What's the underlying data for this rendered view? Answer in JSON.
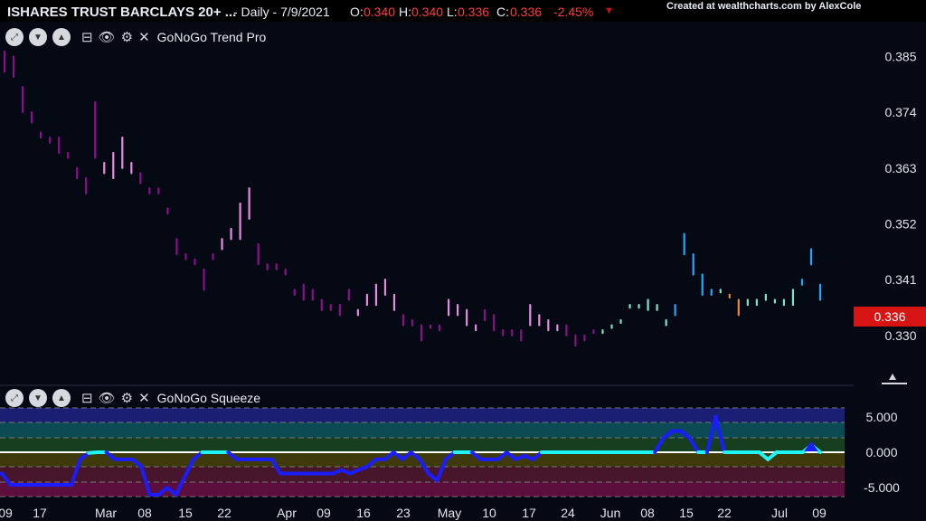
{
  "header": {
    "title": "ISHARES TRUST BARCLAYS 20+ ...",
    "interval_date": "- Daily - 7/9/2021",
    "o_label": "O:",
    "o_value": "0.340",
    "h_label": "H:",
    "h_value": "0.340",
    "l_label": "L:",
    "l_value": "0.336",
    "c_label": "C:",
    "c_value": "0.336",
    "change": "-2.45%",
    "down_icon": "triangle-down-icon",
    "credit": "Created at wealthcharts.com by AlexCole"
  },
  "panels": {
    "price": {
      "title": "GoNoGo Trend Pro",
      "last_price": "0.336"
    },
    "squeeze": {
      "title": "GoNoGo Squeeze"
    }
  },
  "colors": {
    "purple_dark": "#8b0f8d",
    "pink": "#e88be0",
    "aqua_light": "#7fe3c8",
    "blue_bright": "#1ea8ff",
    "amber": "#f08a24",
    "squeeze_blue": "#1a1dff",
    "squeeze_cyan": "#1ef5f5",
    "price_badge": "#d71414"
  },
  "chart_data": [
    {
      "type": "bar",
      "subtype": "ohlc",
      "title": "GoNoGo Trend Pro",
      "y_ticks": [
        "0.385",
        "0.374",
        "0.363",
        "0.352",
        "0.341",
        "0.330"
      ],
      "ylim": [
        0.323,
        0.389
      ],
      "x_ticks": [
        "09",
        "17",
        "Mar",
        "08",
        "15",
        "22",
        "Apr",
        "09",
        "16",
        "23",
        "May",
        "10",
        "17",
        "24",
        "Jun",
        "08",
        "15",
        "22",
        "Jul",
        "09"
      ],
      "last_value": 0.336,
      "series": [
        {
          "values": [
            [
              0.386,
              0.382
            ],
            [
              0.385,
              0.381
            ],
            [
              0.379,
              0.374
            ],
            [
              0.374,
              0.372
            ],
            [
              0.37,
              0.369
            ],
            [
              0.369,
              0.368
            ],
            [
              0.369,
              0.366
            ],
            [
              0.366,
              0.365
            ],
            [
              0.363,
              0.361
            ],
            [
              0.361,
              0.358
            ],
            [
              0.376,
              0.365
            ],
            [
              0.364,
              0.362
            ],
            [
              0.366,
              0.361
            ],
            [
              0.369,
              0.363
            ],
            [
              0.364,
              0.362
            ],
            [
              0.362,
              0.36
            ],
            [
              0.359,
              0.358
            ],
            [
              0.359,
              0.358
            ],
            [
              0.355,
              0.354
            ],
            [
              0.349,
              0.346
            ],
            [
              0.346,
              0.345
            ],
            [
              0.345,
              0.344
            ],
            [
              0.343,
              0.339
            ],
            [
              0.346,
              0.345
            ],
            [
              0.349,
              0.347
            ],
            [
              0.351,
              0.349
            ],
            [
              0.356,
              0.349
            ],
            [
              0.359,
              0.353
            ],
            [
              0.348,
              0.344
            ],
            [
              0.344,
              0.343
            ],
            [
              0.344,
              0.343
            ],
            [
              0.343,
              0.342
            ],
            [
              0.339,
              0.338
            ],
            [
              0.34,
              0.337
            ],
            [
              0.339,
              0.337
            ],
            [
              0.337,
              0.335
            ],
            [
              0.336,
              0.335
            ],
            [
              0.336,
              0.334
            ],
            [
              0.339,
              0.337
            ],
            [
              0.335,
              0.334
            ],
            [
              0.338,
              0.336
            ],
            [
              0.34,
              0.336
            ],
            [
              0.341,
              0.338
            ],
            [
              0.338,
              0.335
            ],
            [
              0.334,
              0.332
            ],
            [
              0.333,
              0.332
            ],
            [
              0.332,
              0.329
            ],
            [
              0.332,
              0.332
            ],
            [
              0.332,
              0.331
            ],
            [
              0.337,
              0.334
            ],
            [
              0.336,
              0.334
            ],
            [
              0.335,
              0.332
            ],
            [
              0.332,
              0.331
            ],
            [
              0.335,
              0.333
            ],
            [
              0.334,
              0.331
            ],
            [
              0.331,
              0.33
            ],
            [
              0.331,
              0.33
            ],
            [
              0.331,
              0.329
            ],
            [
              0.336,
              0.332
            ],
            [
              0.334,
              0.332
            ],
            [
              0.333,
              0.331
            ],
            [
              0.332,
              0.331
            ],
            [
              0.332,
              0.33
            ],
            [
              0.33,
              0.328
            ],
            [
              0.33,
              0.329
            ],
            [
              0.331,
              0.331
            ],
            [
              0.331,
              0.331
            ],
            [
              0.332,
              0.332
            ],
            [
              0.333,
              0.333
            ],
            [
              0.336,
              0.336
            ],
            [
              0.336,
              0.336
            ],
            [
              0.337,
              0.335
            ],
            [
              0.336,
              0.335
            ],
            [
              0.333,
              0.332
            ],
            [
              0.336,
              0.334
            ],
            [
              0.35,
              0.346
            ],
            [
              0.346,
              0.342
            ],
            [
              0.342,
              0.338
            ],
            [
              0.339,
              0.338
            ],
            [
              0.339,
              0.339
            ],
            [
              0.338,
              0.338
            ],
            [
              0.337,
              0.334
            ],
            [
              0.337,
              0.336
            ],
            [
              0.337,
              0.336
            ],
            [
              0.338,
              0.337
            ],
            [
              0.337,
              0.337
            ],
            [
              0.337,
              0.336
            ],
            [
              0.339,
              0.336
            ],
            [
              0.341,
              0.34
            ],
            [
              0.347,
              0.344
            ],
            [
              0.34,
              0.337
            ]
          ]
        }
      ]
    },
    {
      "type": "line",
      "title": "GoNoGo Squeeze",
      "y_ticks": [
        "5.000",
        "0.000",
        "-5.000"
      ],
      "ylim": [
        -6.2,
        6.2
      ],
      "x_ticks": [
        "09",
        "17",
        "Mar",
        "08",
        "15",
        "22",
        "Apr",
        "09",
        "16",
        "23",
        "May",
        "10",
        "17",
        "24",
        "Jun",
        "08",
        "15",
        "22",
        "Jul",
        "09"
      ],
      "series": [
        {
          "values": [
            -3,
            -4.6,
            -4.6,
            -4.6,
            -4.6,
            -4.6,
            -4.6,
            -4.6,
            -4.6,
            -1,
            -0.1,
            0,
            0,
            -1,
            -1,
            -1,
            -2,
            -6,
            -6,
            -5,
            -6,
            -3.5,
            -1,
            0,
            0,
            0,
            0,
            -1,
            -1,
            -1,
            -1,
            -1,
            -3,
            -3,
            -3,
            -3,
            -3,
            -3,
            -3,
            -2.5,
            -3,
            -2.5,
            -2,
            -1,
            -1,
            0,
            -1,
            0,
            -1,
            -3,
            -4,
            -1,
            0,
            0,
            0,
            -1,
            -1,
            -1,
            0,
            -1,
            -0.5,
            -1,
            0,
            0,
            0,
            0,
            0,
            0,
            0,
            0,
            0,
            0,
            0,
            0,
            0,
            0,
            2,
            3,
            3,
            2,
            0,
            0,
            5,
            0,
            0,
            0,
            0,
            0,
            -1,
            0,
            0,
            0,
            0,
            1,
            0
          ]
        }
      ]
    }
  ]
}
